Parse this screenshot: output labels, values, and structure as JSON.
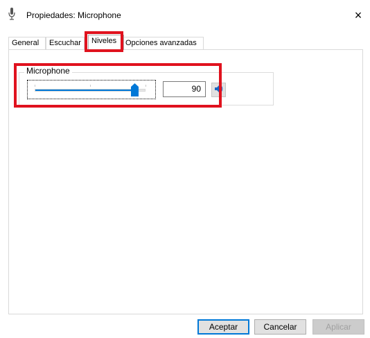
{
  "window": {
    "title": "Propiedades: Microphone",
    "close_glyph": "×"
  },
  "tabs": [
    {
      "label": "General",
      "active": false
    },
    {
      "label": "Escuchar",
      "active": false
    },
    {
      "label": "Niveles",
      "active": true
    },
    {
      "label": "Opciones avanzadas",
      "active": false
    }
  ],
  "levels": {
    "group_label": "Microphone",
    "level_value": "90",
    "level_fraction": 0.9,
    "speaker_icon": "speaker-icon"
  },
  "buttons": {
    "ok_label": "Aceptar",
    "cancel_label": "Cancelar",
    "apply_label": "Aplicar"
  },
  "colors": {
    "accent": "#0078d7",
    "highlight": "#e0121e"
  }
}
